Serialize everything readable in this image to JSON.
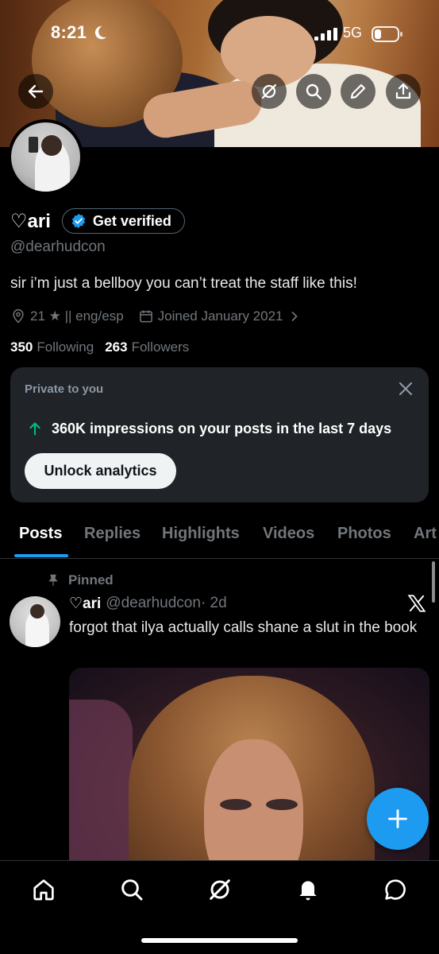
{
  "status_bar": {
    "time": "8:21",
    "network": "5G"
  },
  "profile": {
    "display_name": "♡ari",
    "verify_label": "Get verified",
    "handle": "@dearhudcon",
    "bio": "sir i’m just a bellboy you can’t treat the staff like this!",
    "location": "21 ★ || eng/esp",
    "joined": "Joined January 2021",
    "following_count": "350",
    "following_label": "Following",
    "followers_count": "263",
    "followers_label": "Followers"
  },
  "analytics_card": {
    "private_label": "Private to you",
    "impressions_text": "360K impressions on your posts in the last 7 days",
    "unlock_label": "Unlock analytics"
  },
  "tabs": [
    "Posts",
    "Replies",
    "Highlights",
    "Videos",
    "Photos",
    "Art"
  ],
  "active_tab": "Posts",
  "pinned_post": {
    "pinned_label": "Pinned",
    "author_name": "♡ari",
    "author_handle": "@dearhudcon",
    "age": "· 2d",
    "text": "forgot that ilya actually calls shane a slut in the book"
  },
  "colors": {
    "accent": "#1d9bf0",
    "background": "#000000",
    "muted": "#71767b",
    "card": "#202327"
  },
  "icons": {
    "top_bar": [
      "back-arrow-icon",
      "grok-icon",
      "search-icon",
      "edit-icon",
      "share-icon"
    ],
    "bottom_nav": [
      "home-icon",
      "search-icon",
      "grok-icon",
      "notifications-icon",
      "messages-icon"
    ]
  }
}
